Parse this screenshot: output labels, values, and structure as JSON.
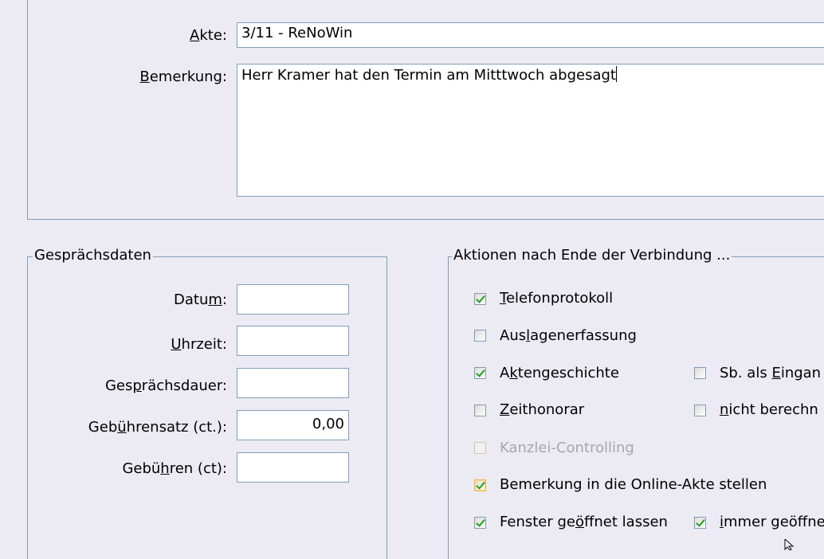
{
  "top": {
    "akte_label": "Akte:",
    "akte_value": "3/11  -  ReNoWin",
    "bemerkung_label": "Bemerkung:",
    "bemerkung_value": "Herr Kramer hat den Termin am Mitttwoch abgesagt"
  },
  "gespraechsdaten": {
    "legend": "Gesprächsdaten",
    "fields": [
      {
        "label": "Datum:",
        "value": ""
      },
      {
        "label": "Uhrzeit:",
        "value": ""
      },
      {
        "label": "Gesprächsdauer:",
        "value": ""
      },
      {
        "label": "Gebührensatz (ct.):",
        "value": "0,00"
      },
      {
        "label": "Gebühren (ct):",
        "value": ""
      }
    ]
  },
  "aktionen": {
    "legend": "Aktionen nach Ende der Verbindung ...",
    "items": [
      {
        "label": "Telefonprotokoll",
        "checked": true
      },
      {
        "label": "Auslagenerfassung",
        "checked": false
      },
      {
        "label": "Aktengeschichte",
        "checked": true
      },
      {
        "label": "Zeithonorar",
        "checked": false
      },
      {
        "label": "Kanzlei-Controlling",
        "checked": false,
        "disabled": true
      },
      {
        "label": "Bemerkung in die Online-Akte stellen",
        "checked": true
      },
      {
        "label": "Fenster geöffnet lassen",
        "checked": true
      }
    ],
    "right_items": [
      {
        "label": "Sb. als Eingan",
        "checked": false
      },
      {
        "label": "nicht berechn",
        "checked": false
      },
      {
        "label": "immer geöffne",
        "checked": true
      }
    ]
  }
}
